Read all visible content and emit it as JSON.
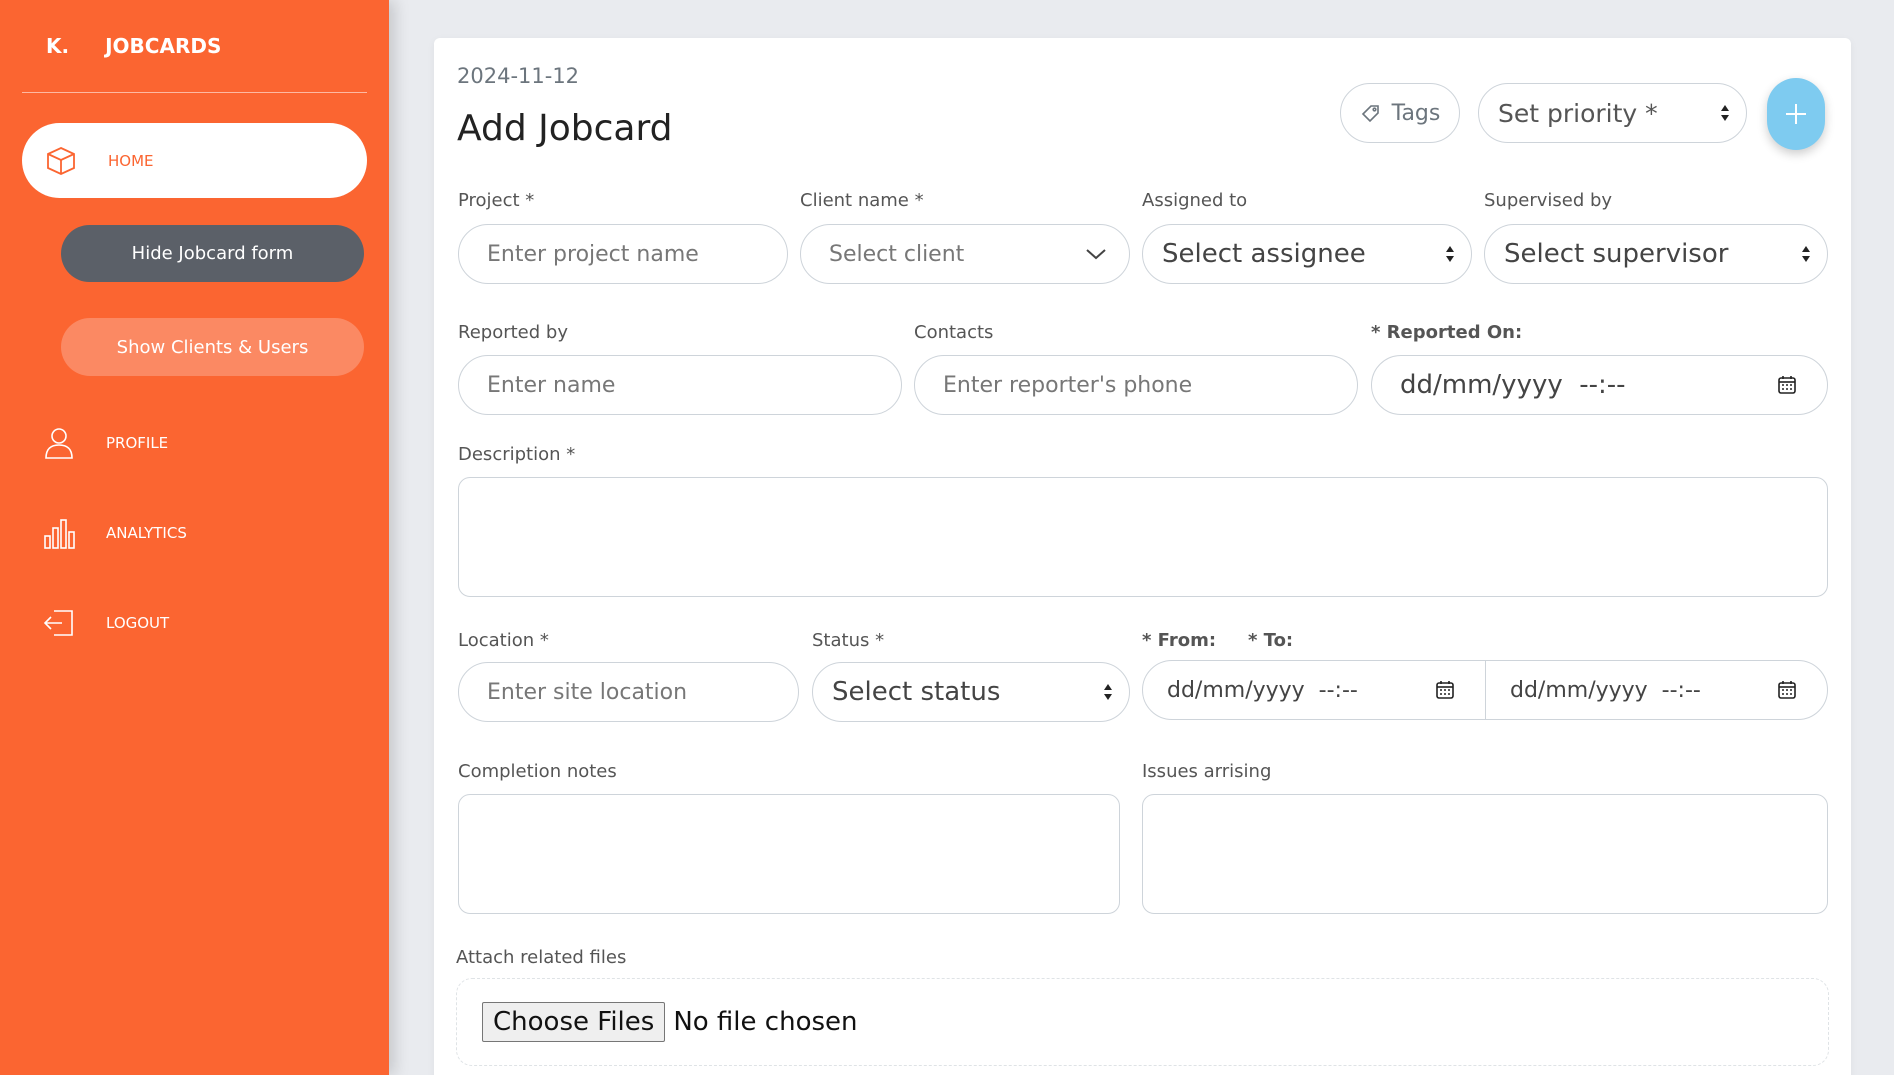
{
  "sidebar": {
    "brand_initial": "K.",
    "brand_name": "JOBCARDS",
    "home_label": "HOME",
    "hide_form_label": "Hide Jobcard form",
    "show_clients_label": "Show Clients & Users",
    "profile_label": "PROFILE",
    "analytics_label": "ANALYTICS",
    "logout_label": "LOGOUT"
  },
  "form": {
    "date": "2024-11-12",
    "title": "Add Jobcard",
    "tags_label": "Tags",
    "priority_value": "Set priority *",
    "project_label": "Project *",
    "project_placeholder": "Enter project name",
    "client_label": "Client name *",
    "client_placeholder": "Select client",
    "assigned_label": "Assigned to",
    "assigned_value": "Select assignee",
    "supervised_label": "Supervised by",
    "supervised_value": "Select supervisor",
    "reported_by_label": "Reported by",
    "reported_by_placeholder": "Enter name",
    "contacts_label": "Contacts",
    "contacts_placeholder": "Enter reporter's phone",
    "reported_on_label": "* Reported On:",
    "reported_on_value": "dd/mm/yyyy  --:--",
    "description_label": "Description *",
    "location_label": "Location *",
    "location_placeholder": "Enter site location",
    "status_label": "Status *",
    "status_value": "Select status",
    "from_label": "* From:",
    "to_label": "* To:",
    "from_value": "dd/mm/yyyy  --:--",
    "to_value": "dd/mm/yyyy  --:--",
    "completion_label": "Completion notes",
    "issues_label": "Issues arrising",
    "attach_label": "Attach related files",
    "choose_files_label": "Choose Files",
    "no_file_label": "No file chosen"
  },
  "colors": {
    "sidebar_bg": "#fb6531",
    "hide_button_bg": "#5b6068",
    "show_button_bg": "#fb8963",
    "fab_bg": "#7ecbf0"
  }
}
